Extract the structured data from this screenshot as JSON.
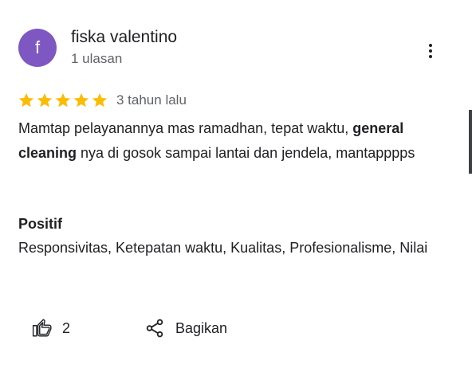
{
  "reviewer": {
    "initial": "f",
    "name": "fiska valentino",
    "meta": "1 ulasan",
    "avatar_color": "#7e57c2"
  },
  "rating": {
    "stars": 5,
    "max_stars": 5,
    "star_color": "#fbbc04",
    "age": "3 tahun lalu"
  },
  "review": {
    "text_before": "Mamtap pelayanannya mas ramadhan, tepat waktu, ",
    "bold_text": "general cleaning",
    "text_after": " nya di gosok sampai lantai dan jendela, mantapppps"
  },
  "positives": {
    "title": "Positif",
    "values": "Responsivitas, Ketepatan waktu, Kualitas, Profesionalisme, Nilai"
  },
  "actions": {
    "like_icon": "thumb-up-icon",
    "like_count": "2",
    "share_icon": "share-icon",
    "share_label": "Bagikan"
  },
  "menu": {
    "icon": "more-vert-icon"
  }
}
